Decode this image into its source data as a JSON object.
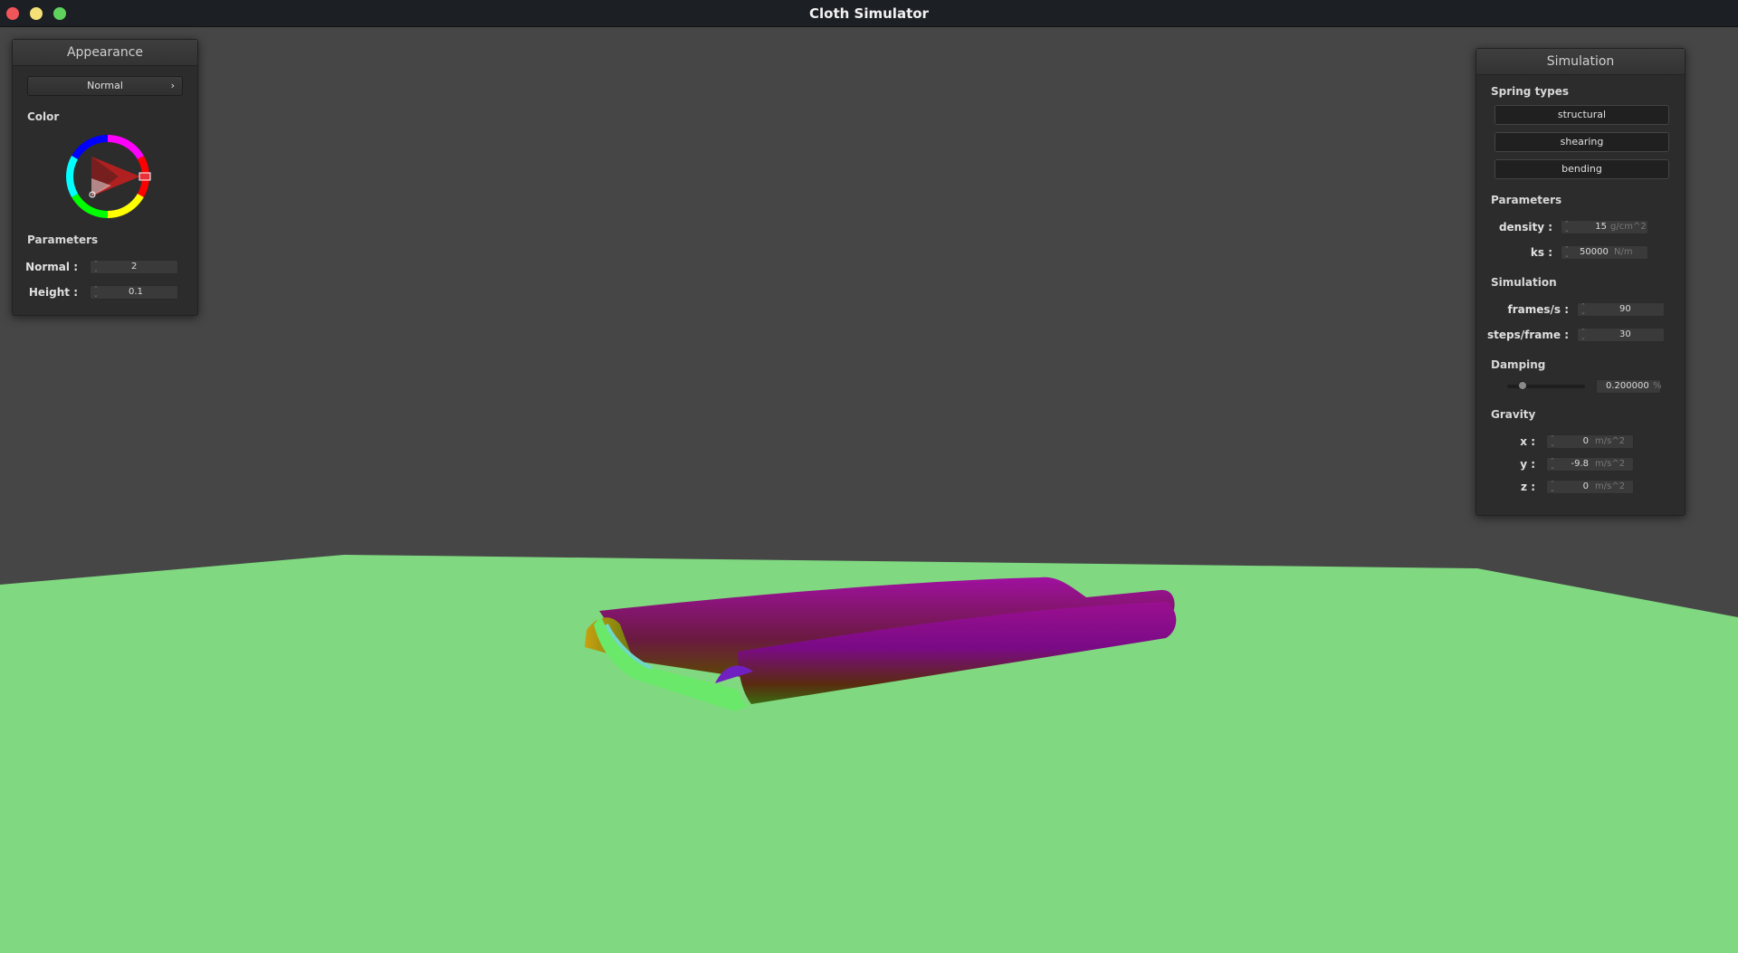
{
  "window": {
    "title": "Cloth Simulator"
  },
  "appearance": {
    "header": "Appearance",
    "mode_select": {
      "value": "Normal",
      "arrow": "›"
    },
    "color_label": "Color",
    "params_label": "Parameters",
    "normal": {
      "label": "Normal :",
      "value": "2"
    },
    "height": {
      "label": "Height :",
      "value": "0.1"
    }
  },
  "simulation": {
    "header": "Simulation",
    "spring_types_label": "Spring types",
    "spring_buttons": [
      "structural",
      "shearing",
      "bending"
    ],
    "params_label": "Parameters",
    "density": {
      "label": "density :",
      "value": "15",
      "unit": "g/cm^2"
    },
    "ks": {
      "label": "ks :",
      "value": "50000",
      "unit": "N/m"
    },
    "sim_label": "Simulation",
    "fps": {
      "label": "frames/s :",
      "value": "90"
    },
    "steps": {
      "label": "steps/frame :",
      "value": "30"
    },
    "damping_label": "Damping",
    "damping": {
      "value": "0.200000",
      "unit": "%",
      "slider_fraction": 0.2
    },
    "gravity_label": "Gravity",
    "gx": {
      "label": "x :",
      "value": "0",
      "unit": "m/s^2"
    },
    "gy": {
      "label": "y :",
      "value": "-9.8",
      "unit": "m/s^2"
    },
    "gz": {
      "label": "z :",
      "value": "0",
      "unit": "m/s^2"
    }
  },
  "colors": {
    "background": "#464646",
    "floor": "#80d880",
    "cloth_primary": "#8a008a",
    "cloth_shadow": "#4a3800",
    "picker_marker": "#e8303a"
  }
}
